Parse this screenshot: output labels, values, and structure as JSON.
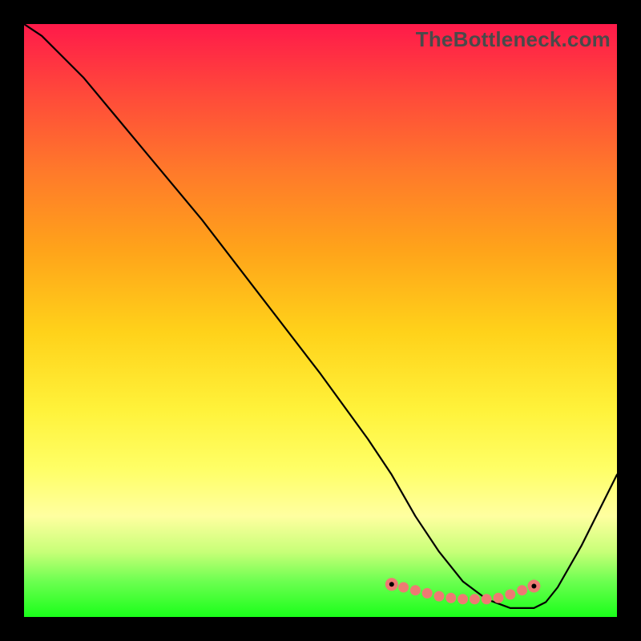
{
  "watermark": "TheBottleneck.com",
  "colors": {
    "frame": "#000000",
    "curve": "#000000",
    "dot": "#ee7a73",
    "gradient_top": "#ff1a4a",
    "gradient_mid": "#fff23a",
    "gradient_bottom": "#1aff1a"
  },
  "chart_data": {
    "type": "line",
    "title": "",
    "xlabel": "",
    "ylabel": "",
    "xlim": [
      0,
      100
    ],
    "ylim": [
      0,
      100
    ],
    "grid": false,
    "legend": false,
    "series": [
      {
        "name": "bottleneck-curve",
        "x": [
          0,
          3,
          6,
          10,
          15,
          20,
          30,
          40,
          50,
          58,
          62,
          66,
          70,
          74,
          78,
          82,
          86,
          88,
          90,
          94,
          100
        ],
        "y": [
          100,
          98,
          95,
          91,
          85,
          79,
          67,
          54,
          41,
          30,
          24,
          17,
          11,
          6,
          3,
          1.5,
          1.5,
          2.5,
          5,
          12,
          24
        ]
      }
    ],
    "markers": {
      "name": "highlight-dots",
      "x": [
        62,
        64,
        66,
        68,
        70,
        72,
        74,
        76,
        78,
        80,
        82,
        84,
        86
      ],
      "y": [
        5.5,
        5,
        4.5,
        4,
        3.5,
        3.2,
        3,
        3,
        3,
        3.2,
        3.8,
        4.5,
        5.2
      ]
    },
    "anchors": {
      "name": "black-anchors",
      "x": [
        62,
        86
      ],
      "y": [
        5.5,
        5.2
      ]
    }
  }
}
